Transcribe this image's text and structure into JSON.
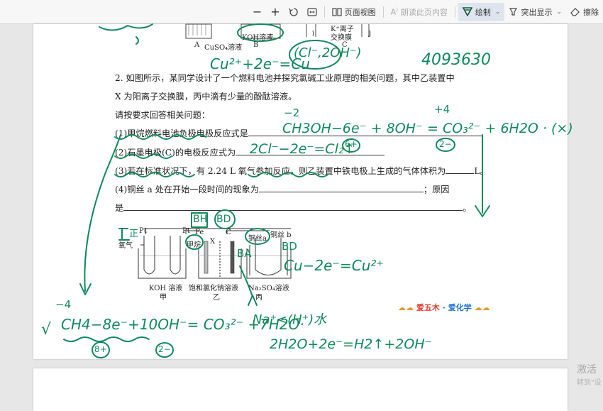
{
  "toolbar": {
    "minus": "−",
    "plus": "+",
    "page_view_label": "页面视图",
    "read_label": "朗读此页内容",
    "draw_label": "绘制",
    "highlight_label": "突出显示",
    "erase_label": "擦除"
  },
  "top_figure": {
    "koh": "KOH溶液",
    "k_membrane_1": "K⁺离子",
    "k_membrane_2": "交换膜",
    "a_label": "A",
    "cuso4": "CuSO₄溶液",
    "b_label": "B",
    "c_label": "C",
    "i_label": "i",
    "j_label": "j"
  },
  "question": {
    "line1": "2. 如图所示，某同学设计了一个燃料电池并探究氯碱工业原理的相关问题，其中乙装置中",
    "line2": "X 为阳离子交换膜，丙中滴有少量的酚酞溶液。",
    "line3": "请按要求回答相关问题：",
    "p1": "(1)甲烷燃料电池负极电极反应式是",
    "p2": "(2)石墨电极(C)的电极反应式为",
    "p3a": "(3)若在标准状况下，有 2.24 L 氧气参加反应，则乙装置中铁电极上生成的气体体积为",
    "p3b": "L。",
    "p4a": "(4)铜丝 a 处在开始一段时间的现象为",
    "p4b": "；原因",
    "p5a": "是",
    "p5b": "。"
  },
  "diagram": {
    "pt1": "Pt",
    "pt2": "Pt",
    "fe": "Fe",
    "c": "C",
    "x": "X",
    "oxygen": "氧气",
    "methane": "甲烷",
    "cu_a": "铜丝a",
    "cu_b": "铜丝 b",
    "koh": "KOH 溶液",
    "nacl": "饱和氯化钠溶液",
    "na2so4": "Na₂SO₄溶液",
    "jia": "甲",
    "yi": "乙",
    "bing": "丙"
  },
  "logo": {
    "text1": "爱五木",
    "dot": "·",
    "text2": "爱化学"
  },
  "activate": {
    "line1": "激活",
    "line2": "转到\"设"
  },
  "ink_notes": {
    "eq_top": "Cu²⁺+2e⁻=Cu",
    "cl_note": "(Cl⁻,2OH⁻)",
    "number": "4093630",
    "eq1": "CH3OH−6e⁻ + 8OH⁻ = CO₃²⁻ + 6H2O · (×)",
    "p1_6": "6+",
    "p1_2": "2−",
    "p1_4": "+4",
    "p1_minus2": "−2",
    "eq2": "2Cl⁻−2e⁻=Cl₂↑",
    "eq_cu": "Cu−2e⁻=Cu²⁺",
    "bh": "BH",
    "bd": "BD",
    "bd2": "BD",
    "ba": "BA",
    "zheng": "正",
    "eq_ch4": "CH4−8e⁻+10OH⁻= CO₃²⁻ +7H2O·",
    "ch4_8": "8+",
    "ch4_2": "2−",
    "ch4_minus4": "−4",
    "na_h": "Na⁺<(H⁺)水",
    "eq_h2o": "2H2O+2e⁻=H2↑+2OH⁻",
    "check": "√"
  },
  "colors": {
    "ink": "#0f8a5a",
    "highlight": "#0b6a4c",
    "logo_red": "#e33a2b",
    "logo_blue": "#1f6fd1"
  }
}
